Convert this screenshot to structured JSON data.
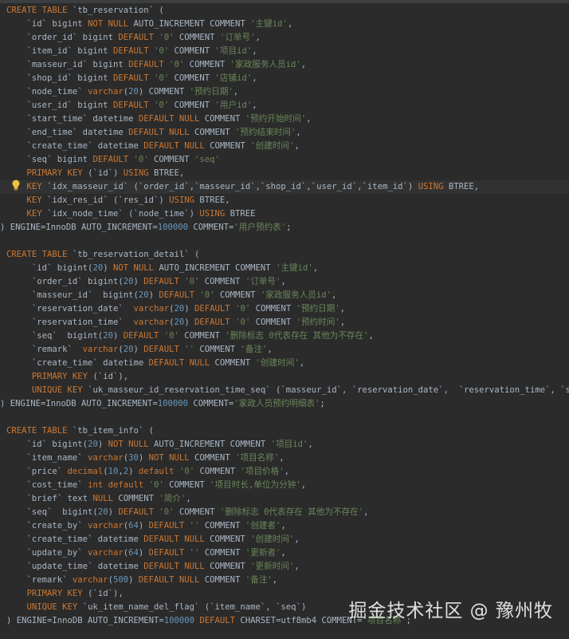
{
  "editor": {
    "lines": [
      [
        [
          "kw",
          "CREATE TABLE "
        ],
        [
          "id",
          "`tb_reservation` ("
        ]
      ],
      [
        [
          "pl",
          "    "
        ],
        [
          "id",
          "`id` bigint "
        ],
        [
          "kw",
          "NOT NULL "
        ],
        [
          "pl",
          "AUTO_INCREMENT COMMENT "
        ],
        [
          "str",
          "'主键id'"
        ],
        [
          "pl",
          ","
        ]
      ],
      [
        [
          "pl",
          "    "
        ],
        [
          "id",
          "`order_id` bigint "
        ],
        [
          "kw",
          "DEFAULT "
        ],
        [
          "str",
          "'0'"
        ],
        [
          "pl",
          " COMMENT "
        ],
        [
          "str",
          "'订单号'"
        ],
        [
          "pl",
          ","
        ]
      ],
      [
        [
          "pl",
          "    "
        ],
        [
          "id",
          "`item_id` bigint "
        ],
        [
          "kw",
          "DEFAULT "
        ],
        [
          "str",
          "'0'"
        ],
        [
          "pl",
          " COMMENT "
        ],
        [
          "str",
          "'项目id'"
        ],
        [
          "pl",
          ","
        ]
      ],
      [
        [
          "pl",
          "    "
        ],
        [
          "id",
          "`masseur_id` bigint "
        ],
        [
          "kw",
          "DEFAULT "
        ],
        [
          "str",
          "'0'"
        ],
        [
          "pl",
          " COMMENT "
        ],
        [
          "str",
          "'家政服务人员id'"
        ],
        [
          "pl",
          ","
        ]
      ],
      [
        [
          "pl",
          "    "
        ],
        [
          "id",
          "`shop_id` bigint "
        ],
        [
          "kw",
          "DEFAULT "
        ],
        [
          "str",
          "'0'"
        ],
        [
          "pl",
          " COMMENT "
        ],
        [
          "str",
          "'店铺id'"
        ],
        [
          "pl",
          ","
        ]
      ],
      [
        [
          "pl",
          "    "
        ],
        [
          "id",
          "`node_time` "
        ],
        [
          "kw",
          "varchar"
        ],
        [
          "pl",
          "("
        ],
        [
          "num",
          "20"
        ],
        [
          "pl",
          ") COMMENT "
        ],
        [
          "str",
          "'预约日期'"
        ],
        [
          "pl",
          ","
        ]
      ],
      [
        [
          "pl",
          "    "
        ],
        [
          "id",
          "`user_id` bigint "
        ],
        [
          "kw",
          "DEFAULT "
        ],
        [
          "str",
          "'0'"
        ],
        [
          "pl",
          " COMMENT "
        ],
        [
          "str",
          "'用户id'"
        ],
        [
          "pl",
          ","
        ]
      ],
      [
        [
          "pl",
          "    "
        ],
        [
          "id",
          "`start_time` datetime "
        ],
        [
          "kw",
          "DEFAULT NULL "
        ],
        [
          "pl",
          "COMMENT "
        ],
        [
          "str",
          "'预约开始时间'"
        ],
        [
          "pl",
          ","
        ]
      ],
      [
        [
          "pl",
          "    "
        ],
        [
          "id",
          "`end_time` datetime "
        ],
        [
          "kw",
          "DEFAULT NULL "
        ],
        [
          "pl",
          "COMMENT "
        ],
        [
          "str",
          "'预约结束时间'"
        ],
        [
          "pl",
          ","
        ]
      ],
      [
        [
          "pl",
          "    "
        ],
        [
          "id",
          "`create_time` datetime "
        ],
        [
          "kw",
          "DEFAULT NULL "
        ],
        [
          "pl",
          "COMMENT "
        ],
        [
          "str",
          "'创建时间'"
        ],
        [
          "pl",
          ","
        ]
      ],
      [
        [
          "pl",
          "    "
        ],
        [
          "id",
          "`seq` bigint "
        ],
        [
          "kw",
          "DEFAULT "
        ],
        [
          "str",
          "'0'"
        ],
        [
          "pl",
          " COMMENT "
        ],
        [
          "str",
          "'seq'"
        ]
      ],
      [
        [
          "pl",
          "    "
        ],
        [
          "kw",
          "PRIMARY KEY "
        ],
        [
          "id",
          "(`id`) "
        ],
        [
          "kw",
          "USING "
        ],
        [
          "pl",
          "BTREE,"
        ]
      ],
      [
        [
          "pl",
          "    "
        ],
        [
          "kw",
          "KEY "
        ],
        [
          "id",
          "`idx_masseur_id` (`order_id`,`masseur_id`,`shop_id`,`user_id`,`item_id`) "
        ],
        [
          "kw",
          "USING "
        ],
        [
          "pl",
          "BTREE,"
        ]
      ],
      [
        [
          "pl",
          "    "
        ],
        [
          "kw",
          "KEY "
        ],
        [
          "id",
          "`idx_res_id` (`res_id`) "
        ],
        [
          "kw",
          "USING "
        ],
        [
          "pl",
          "BTREE,"
        ]
      ],
      [
        [
          "pl",
          "    "
        ],
        [
          "kw",
          "KEY "
        ],
        [
          "id",
          "`idx_node_time` (`node_time`) "
        ],
        [
          "kw",
          "USING "
        ],
        [
          "pl",
          "BTREE"
        ]
      ],
      [
        [
          "pl",
          ") ENGINE=InnoDB AUTO_INCREMENT="
        ],
        [
          "num",
          "100000"
        ],
        [
          "pl",
          " COMMENT="
        ],
        [
          "str",
          "'用户预约表'"
        ],
        [
          "pl",
          ";"
        ]
      ],
      [],
      [
        [
          "kw",
          "CREATE TABLE "
        ],
        [
          "id",
          "`tb_reservation_detail` ("
        ]
      ],
      [
        [
          "pl",
          "     "
        ],
        [
          "id",
          "`id` bigint("
        ],
        [
          "num",
          "20"
        ],
        [
          "pl",
          ") "
        ],
        [
          "kw",
          "NOT NULL "
        ],
        [
          "pl",
          "AUTO_INCREMENT COMMENT "
        ],
        [
          "str",
          "'主键id'"
        ],
        [
          "pl",
          ","
        ]
      ],
      [
        [
          "pl",
          "     "
        ],
        [
          "id",
          "`order_id` bigint("
        ],
        [
          "num",
          "20"
        ],
        [
          "pl",
          ") "
        ],
        [
          "kw",
          "DEFAULT "
        ],
        [
          "str",
          "'0'"
        ],
        [
          "pl",
          " COMMENT "
        ],
        [
          "str",
          "'订单号'"
        ],
        [
          "pl",
          ","
        ]
      ],
      [
        [
          "pl",
          "     "
        ],
        [
          "id",
          "`masseur_id`  bigint("
        ],
        [
          "num",
          "20"
        ],
        [
          "pl",
          ") "
        ],
        [
          "kw",
          "DEFAULT "
        ],
        [
          "str",
          "'0'"
        ],
        [
          "pl",
          " COMMENT "
        ],
        [
          "str",
          "'家政服务人员id'"
        ],
        [
          "pl",
          ","
        ]
      ],
      [
        [
          "pl",
          "     "
        ],
        [
          "id",
          "`reservation_date`  "
        ],
        [
          "kw",
          "varchar"
        ],
        [
          "pl",
          "("
        ],
        [
          "num",
          "20"
        ],
        [
          "pl",
          ") "
        ],
        [
          "kw",
          "DEFAULT "
        ],
        [
          "str",
          "'0'"
        ],
        [
          "pl",
          " COMMENT "
        ],
        [
          "str",
          "'预约日期'"
        ],
        [
          "pl",
          ","
        ]
      ],
      [
        [
          "pl",
          "     "
        ],
        [
          "id",
          "`reservation_time`  "
        ],
        [
          "kw",
          "varchar"
        ],
        [
          "pl",
          "("
        ],
        [
          "num",
          "20"
        ],
        [
          "pl",
          ") "
        ],
        [
          "kw",
          "DEFAULT "
        ],
        [
          "str",
          "'0'"
        ],
        [
          "pl",
          " COMMENT "
        ],
        [
          "str",
          "'预约时间'"
        ],
        [
          "pl",
          ","
        ]
      ],
      [
        [
          "pl",
          "     "
        ],
        [
          "id",
          "`seq`  bigint("
        ],
        [
          "num",
          "20"
        ],
        [
          "pl",
          ") "
        ],
        [
          "kw",
          "DEFAULT "
        ],
        [
          "str",
          "'0'"
        ],
        [
          "pl",
          " COMMENT "
        ],
        [
          "str",
          "'删除标志 0代表存在 其他为不存在'"
        ],
        [
          "pl",
          ","
        ]
      ],
      [
        [
          "pl",
          "     "
        ],
        [
          "id",
          "`remark`  "
        ],
        [
          "kw",
          "varchar"
        ],
        [
          "pl",
          "("
        ],
        [
          "num",
          "20"
        ],
        [
          "pl",
          ") "
        ],
        [
          "kw",
          "DEFAULT "
        ],
        [
          "str",
          "''"
        ],
        [
          "pl",
          " COMMENT "
        ],
        [
          "str",
          "'备注'"
        ],
        [
          "pl",
          ","
        ]
      ],
      [
        [
          "pl",
          "     "
        ],
        [
          "id",
          "`create_time` datetime "
        ],
        [
          "kw",
          "DEFAULT NULL "
        ],
        [
          "pl",
          "COMMENT "
        ],
        [
          "str",
          "'创建时间'"
        ],
        [
          "pl",
          ","
        ]
      ],
      [
        [
          "pl",
          "     "
        ],
        [
          "kw",
          "PRIMARY KEY "
        ],
        [
          "id",
          "(`id`),"
        ]
      ],
      [
        [
          "pl",
          "     "
        ],
        [
          "kw",
          "UNIQUE KEY "
        ],
        [
          "id",
          "`uk_masseur_id_reservation_time_seq` (`masseur_id`, `reservation_date`,  `reservation_time`, `seq`)"
        ]
      ],
      [
        [
          "pl",
          ") ENGINE=InnoDB AUTO_INCREMENT="
        ],
        [
          "num",
          "100000"
        ],
        [
          "pl",
          " COMMENT="
        ],
        [
          "str",
          "'家政人员预约明细表'"
        ],
        [
          "pl",
          ";"
        ]
      ],
      [],
      [
        [
          "kw",
          "CREATE TABLE "
        ],
        [
          "id",
          "`tb_item_info` ("
        ]
      ],
      [
        [
          "pl",
          "    "
        ],
        [
          "id",
          "`id` bigint("
        ],
        [
          "num",
          "20"
        ],
        [
          "pl",
          ") "
        ],
        [
          "kw",
          "NOT NULL "
        ],
        [
          "pl",
          "AUTO_INCREMENT COMMENT "
        ],
        [
          "str",
          "'项目id'"
        ],
        [
          "pl",
          ","
        ]
      ],
      [
        [
          "pl",
          "    "
        ],
        [
          "id",
          "`item_name` "
        ],
        [
          "kw",
          "varchar"
        ],
        [
          "pl",
          "("
        ],
        [
          "num",
          "30"
        ],
        [
          "pl",
          ") "
        ],
        [
          "kw",
          "NOT NULL "
        ],
        [
          "pl",
          "COMMENT "
        ],
        [
          "str",
          "'项目名称'"
        ],
        [
          "pl",
          ","
        ]
      ],
      [
        [
          "pl",
          "    "
        ],
        [
          "id",
          "`price` "
        ],
        [
          "kw",
          "decimal"
        ],
        [
          "pl",
          "("
        ],
        [
          "num",
          "10"
        ],
        [
          "pl",
          ","
        ],
        [
          "num",
          "2"
        ],
        [
          "pl",
          ") "
        ],
        [
          "kw",
          "default "
        ],
        [
          "str",
          "'0'"
        ],
        [
          "pl",
          " COMMENT "
        ],
        [
          "str",
          "'项目价格'"
        ],
        [
          "pl",
          ","
        ]
      ],
      [
        [
          "pl",
          "    "
        ],
        [
          "id",
          "`cost_time` "
        ],
        [
          "kw",
          "int default "
        ],
        [
          "str",
          "'0'"
        ],
        [
          "pl",
          " COMMENT "
        ],
        [
          "str",
          "'项目时长,单位为分钟'"
        ],
        [
          "pl",
          ","
        ]
      ],
      [
        [
          "pl",
          "    "
        ],
        [
          "id",
          "`brief` text "
        ],
        [
          "kw",
          "NULL "
        ],
        [
          "pl",
          "COMMENT "
        ],
        [
          "str",
          "'简介'"
        ],
        [
          "pl",
          ","
        ]
      ],
      [
        [
          "pl",
          "    "
        ],
        [
          "id",
          "`seq`  bigint("
        ],
        [
          "num",
          "20"
        ],
        [
          "pl",
          ") "
        ],
        [
          "kw",
          "DEFAULT "
        ],
        [
          "str",
          "'0'"
        ],
        [
          "pl",
          " COMMENT "
        ],
        [
          "str",
          "'删除标志 0代表存在 其他为不存在'"
        ],
        [
          "pl",
          ","
        ]
      ],
      [
        [
          "pl",
          "    "
        ],
        [
          "id",
          "`create_by` "
        ],
        [
          "kw",
          "varchar"
        ],
        [
          "pl",
          "("
        ],
        [
          "num",
          "64"
        ],
        [
          "pl",
          ") "
        ],
        [
          "kw",
          "DEFAULT "
        ],
        [
          "str",
          "''"
        ],
        [
          "pl",
          " COMMENT "
        ],
        [
          "str",
          "'创建者'"
        ],
        [
          "pl",
          ","
        ]
      ],
      [
        [
          "pl",
          "    "
        ],
        [
          "id",
          "`create_time` datetime "
        ],
        [
          "kw",
          "DEFAULT NULL "
        ],
        [
          "pl",
          "COMMENT "
        ],
        [
          "str",
          "'创建时间'"
        ],
        [
          "pl",
          ","
        ]
      ],
      [
        [
          "pl",
          "    "
        ],
        [
          "id",
          "`update_by` "
        ],
        [
          "kw",
          "varchar"
        ],
        [
          "pl",
          "("
        ],
        [
          "num",
          "64"
        ],
        [
          "pl",
          ") "
        ],
        [
          "kw",
          "DEFAULT "
        ],
        [
          "str",
          "''"
        ],
        [
          "pl",
          " COMMENT "
        ],
        [
          "str",
          "'更新者'"
        ],
        [
          "pl",
          ","
        ]
      ],
      [
        [
          "pl",
          "    "
        ],
        [
          "id",
          "`update_time` datetime "
        ],
        [
          "kw",
          "DEFAULT NULL "
        ],
        [
          "pl",
          "COMMENT "
        ],
        [
          "str",
          "'更新时间'"
        ],
        [
          "pl",
          ","
        ]
      ],
      [
        [
          "pl",
          "    "
        ],
        [
          "id",
          "`remark` "
        ],
        [
          "kw",
          "varchar"
        ],
        [
          "pl",
          "("
        ],
        [
          "num",
          "500"
        ],
        [
          "pl",
          ") "
        ],
        [
          "kw",
          "DEFAULT NULL "
        ],
        [
          "pl",
          "COMMENT "
        ],
        [
          "str",
          "'备注'"
        ],
        [
          "pl",
          ","
        ]
      ],
      [
        [
          "pl",
          "    "
        ],
        [
          "kw",
          "PRIMARY KEY "
        ],
        [
          "id",
          "(`id`),"
        ]
      ],
      [
        [
          "pl",
          "    "
        ],
        [
          "kw",
          "UNIQUE KEY "
        ],
        [
          "id",
          "`uk_item_name_del_flag` (`item_name`, `seq`)"
        ]
      ],
      [
        [
          "pl",
          ") ENGINE=InnoDB AUTO_INCREMENT="
        ],
        [
          "num",
          "100000"
        ],
        [
          "pl",
          " "
        ],
        [
          "kw",
          "DEFAULT "
        ],
        [
          "pl",
          "CHARSET=utf8mb4 COMMENT="
        ],
        [
          "str",
          "'项目名称'"
        ],
        [
          "pl",
          ";"
        ]
      ]
    ],
    "folded_lines": [
      16,
      29,
      46
    ],
    "caret_line": 13
  },
  "colors": {
    "background": "#2b2b2b",
    "keyword": "#cc7832",
    "string": "#6a8759",
    "number": "#6897bb",
    "identifier": "#a9b7c6"
  },
  "intention_icon": "lightbulb-icon",
  "watermark": "掘金技术社区 @ 豫州牧"
}
